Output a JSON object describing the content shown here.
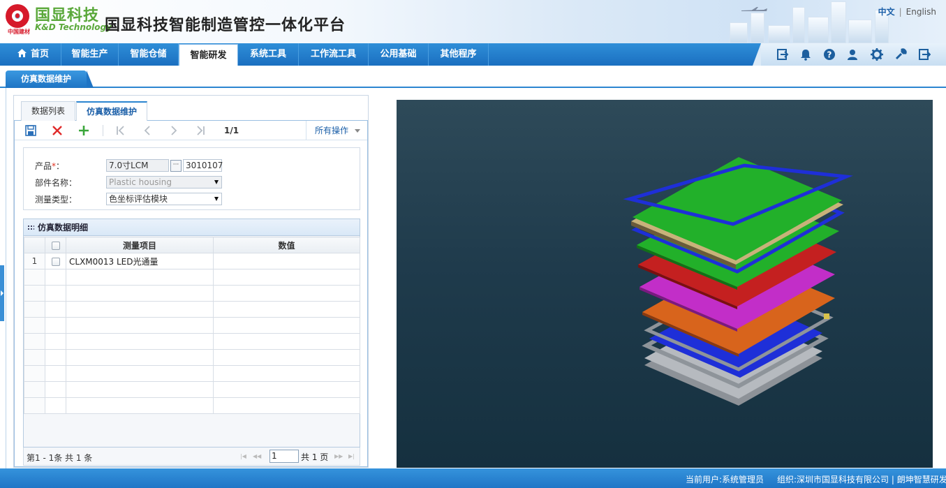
{
  "header": {
    "logo_cn": "国显科技",
    "logo_en": "K&D Technology",
    "logo_sub": "中国建材",
    "title": "国显科技智能制造管控一体化平台",
    "lang_cn": "中文",
    "lang_sep": "|",
    "lang_en": "English"
  },
  "nav": {
    "items": [
      {
        "label": "首页"
      },
      {
        "label": "智能生产"
      },
      {
        "label": "智能仓储"
      },
      {
        "label": "智能研发"
      },
      {
        "label": "系统工具"
      },
      {
        "label": "工作流工具"
      },
      {
        "label": "公用基础"
      },
      {
        "label": "其他程序"
      }
    ],
    "active_index": 3,
    "icons": [
      "login-icon",
      "bell-icon",
      "help-icon",
      "user-icon",
      "gear-icon",
      "wrench-icon",
      "logout-icon"
    ]
  },
  "page_tab": {
    "label": "仿真数据维护"
  },
  "sub_tabs": [
    {
      "label": "数据列表"
    },
    {
      "label": "仿真数据维护"
    }
  ],
  "toolbar": {
    "page_count": "1/1",
    "all_ops": "所有操作",
    "icons": [
      "save-icon",
      "delete-icon",
      "add-icon",
      "first-page-icon",
      "prev-page-icon",
      "next-page-icon",
      "last-page-icon"
    ]
  },
  "form": {
    "product_label": "产品",
    "required_mark": "*",
    "colon": "：",
    "product_value": "7.0寸LCM",
    "product_code": "3010107",
    "lookup_button": "···",
    "part_label": "部件名称：",
    "part_value": "Plastic housing",
    "type_label": "测量类型：",
    "type_value": "色坐标评估模块"
  },
  "grid": {
    "title": "仿真数据明细",
    "columns": [
      "测量项目",
      "数值"
    ],
    "rows": [
      {
        "num": "1",
        "item": "CLXM0013  LED光通量",
        "value": ""
      }
    ]
  },
  "pager": {
    "info": "第1 - 1条   共 1 条",
    "page_input": "1",
    "total": "共 1 页"
  },
  "footer": {
    "user": "当前用户:系统管理员",
    "org": "组织:深圳市国显科技有限公司 | 朗坤智慧研发"
  },
  "colors": {
    "nav_blue": "#1a6fc0",
    "accent_green": "#5aa83a",
    "brand_red": "#d6192a",
    "layer_blue": "#1e2fd8",
    "layer_green": "#22b02a",
    "layer_red": "#c42020",
    "layer_magenta": "#c22ec8",
    "layer_orange": "#d8641c",
    "layer_gray": "#8a8f95"
  }
}
